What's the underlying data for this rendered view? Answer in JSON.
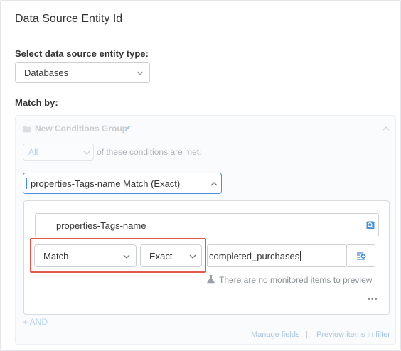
{
  "panel": {
    "title": "Data Source Entity Id"
  },
  "entity_type": {
    "label": "Select data source entity type:",
    "selected": "Databases"
  },
  "match_by": {
    "label": "Match by:"
  },
  "group": {
    "title": "New Conditions Group",
    "quantifier": "All",
    "quantifier_suffix": "of these conditions are met:",
    "condition_selector": "properties-Tags-name Match (Exact)",
    "field_name": "properties-Tags-name",
    "operator": "Match",
    "mode": "Exact",
    "value": "completed_purchases",
    "preview_note": "There are no monitored items to preview",
    "more_label": "•••",
    "add_and": "+ AND"
  },
  "footer": {
    "manage_fields": "Manage fields",
    "separator": "|",
    "preview_items": "Preview items in filter"
  },
  "colors": {
    "accent": "#4a90d9",
    "highlight": "#e25a4f",
    "disabled_text": "#c9ccd0"
  }
}
